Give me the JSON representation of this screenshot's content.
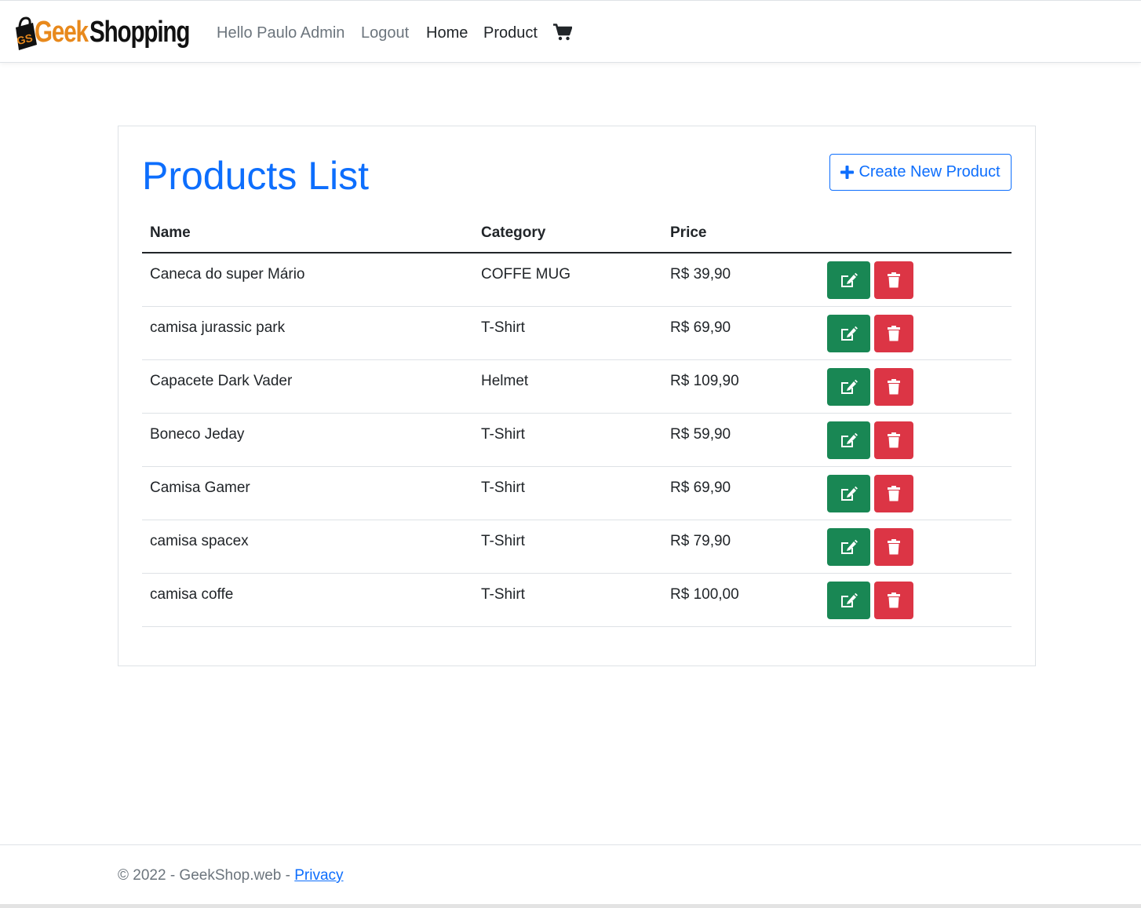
{
  "navbar": {
    "brand_geek": "Geek",
    "brand_shopping": "Shopping",
    "brand_logo_letters": "GS",
    "greeting": "Hello Paulo Admin",
    "logout": "Logout",
    "home": "Home",
    "product": "Product",
    "cart_icon": "shopping-cart-icon"
  },
  "main": {
    "title": "Products List",
    "create_button": "Create New Product",
    "columns": [
      "Name",
      "Category",
      "Price"
    ],
    "products": [
      {
        "name": "Caneca do super Mário",
        "category": "COFFE MUG",
        "price": "R$ 39,90"
      },
      {
        "name": "camisa jurassic park",
        "category": "T-Shirt",
        "price": "R$ 69,90"
      },
      {
        "name": "Capacete Dark Vader",
        "category": "Helmet",
        "price": "R$ 109,90"
      },
      {
        "name": "Boneco Jeday",
        "category": "T-Shirt",
        "price": "R$ 59,90"
      },
      {
        "name": "Camisa Gamer",
        "category": "T-Shirt",
        "price": "R$ 69,90"
      },
      {
        "name": "camisa spacex",
        "category": "T-Shirt",
        "price": "R$ 79,90"
      },
      {
        "name": "camisa coffe",
        "category": "T-Shirt",
        "price": "R$ 100,00"
      }
    ]
  },
  "footer": {
    "copyright": "© 2022 - GeekShop.web - ",
    "privacy": "Privacy"
  },
  "colors": {
    "primary": "#0d6efd",
    "edit": "#198754",
    "delete": "#dc3545",
    "brand_orange": "#e8891c"
  }
}
